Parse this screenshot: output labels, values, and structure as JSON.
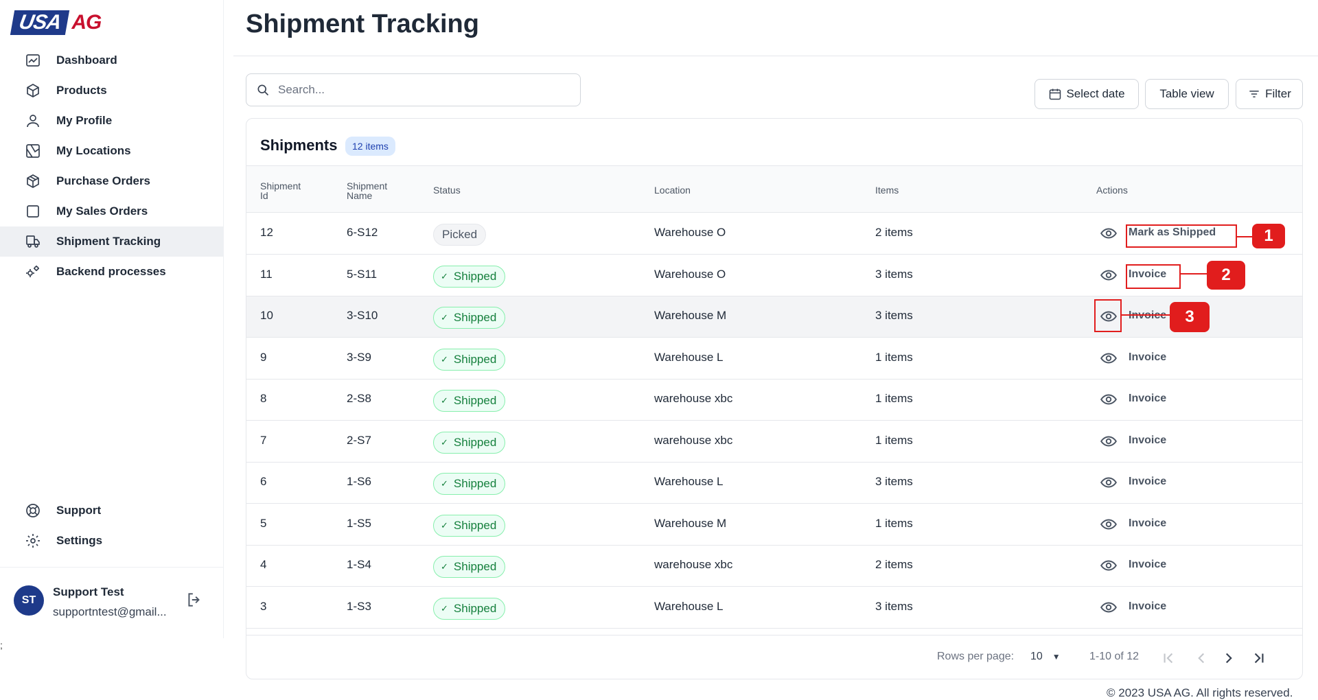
{
  "brand": {
    "logo_usa": "USA",
    "logo_ag": "AG"
  },
  "sidebar": {
    "items": [
      {
        "label": "Dashboard",
        "icon": "chart-icon"
      },
      {
        "label": "Products",
        "icon": "box-icon"
      },
      {
        "label": "My Profile",
        "icon": "user-icon"
      },
      {
        "label": "My Locations",
        "icon": "map-icon"
      },
      {
        "label": "Purchase Orders",
        "icon": "package-icon"
      },
      {
        "label": "My Sales Orders",
        "icon": "square-icon"
      },
      {
        "label": "Shipment Tracking",
        "icon": "truck-icon",
        "active": true
      },
      {
        "label": "Backend processes",
        "icon": "gears-icon"
      }
    ],
    "bottom_items": [
      {
        "label": "Support",
        "icon": "lifebuoy-icon"
      },
      {
        "label": "Settings",
        "icon": "gear-icon"
      }
    ],
    "user": {
      "initials": "ST",
      "name": "Support Test",
      "email": "supportntest@gmail..."
    },
    "stray_text": ";"
  },
  "header": {
    "title": "Shipment Tracking"
  },
  "toolbar": {
    "search_placeholder": "Search...",
    "select_date": "Select date",
    "table_view": "Table view",
    "filter": "Filter"
  },
  "shipments": {
    "title": "Shipments",
    "count_badge": "12 items",
    "columns": {
      "id_line1": "Shipment",
      "id_line2": "Id",
      "name_line1": "Shipment",
      "name_line2": "Name",
      "status": "Status",
      "location": "Location",
      "items": "Items",
      "actions": "Actions"
    },
    "rows": [
      {
        "id": "12",
        "name": "6-S12",
        "status": "Picked",
        "location": "Warehouse O",
        "items": "2 items",
        "action": "Mark as Shipped"
      },
      {
        "id": "11",
        "name": "5-S11",
        "status": "Shipped",
        "location": "Warehouse O",
        "items": "3 items",
        "action": "Invoice"
      },
      {
        "id": "10",
        "name": "3-S10",
        "status": "Shipped",
        "location": "Warehouse M",
        "items": "3 items",
        "action": "Invoice"
      },
      {
        "id": "9",
        "name": "3-S9",
        "status": "Shipped",
        "location": "Warehouse L",
        "items": "1 items",
        "action": "Invoice"
      },
      {
        "id": "8",
        "name": "2-S8",
        "status": "Shipped",
        "location": "warehouse xbc",
        "items": "1 items",
        "action": "Invoice"
      },
      {
        "id": "7",
        "name": "2-S7",
        "status": "Shipped",
        "location": "warehouse xbc",
        "items": "1 items",
        "action": "Invoice"
      },
      {
        "id": "6",
        "name": "1-S6",
        "status": "Shipped",
        "location": "Warehouse L",
        "items": "3 items",
        "action": "Invoice"
      },
      {
        "id": "5",
        "name": "1-S5",
        "status": "Shipped",
        "location": "Warehouse M",
        "items": "1 items",
        "action": "Invoice"
      },
      {
        "id": "4",
        "name": "1-S4",
        "status": "Shipped",
        "location": "warehouse xbc",
        "items": "2 items",
        "action": "Invoice"
      },
      {
        "id": "3",
        "name": "1-S3",
        "status": "Shipped",
        "location": "Warehouse L",
        "items": "3 items",
        "action": "Invoice"
      }
    ],
    "pagination": {
      "rows_per_page_label": "Rows per page:",
      "rows_per_page": "10",
      "range": "1-10 of 12"
    }
  },
  "footer": {
    "copyright": "© 2023 USA AG. All rights reserved."
  },
  "annotations": [
    "1",
    "2",
    "3"
  ],
  "colors": {
    "accent": "#1e3a8a",
    "brand_red": "#c8102e",
    "annotation": "#e11d1d",
    "shipped_green": "#15803d"
  }
}
